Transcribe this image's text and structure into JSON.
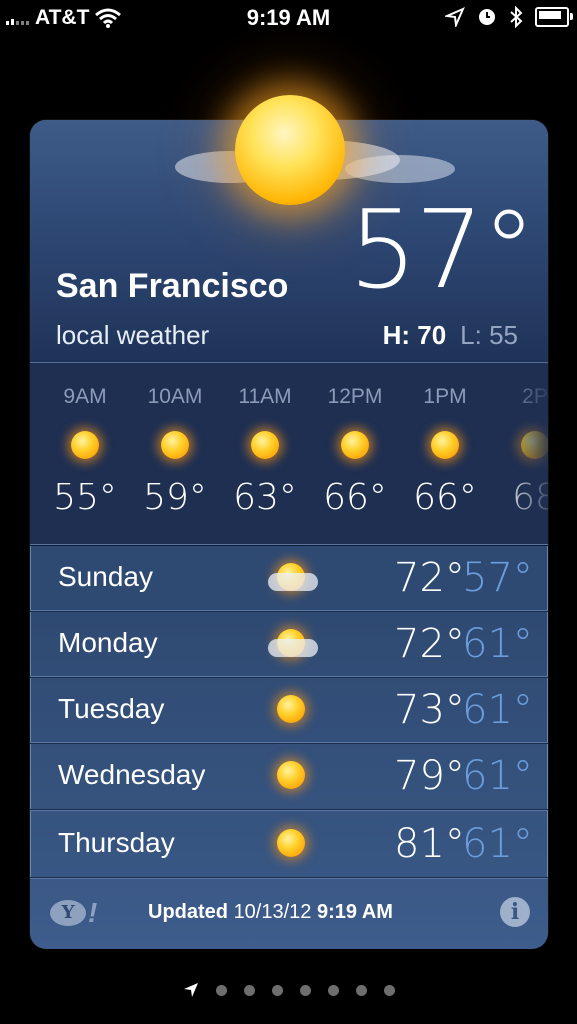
{
  "status_bar": {
    "carrier": "AT&T",
    "time": "9:19 AM"
  },
  "header": {
    "city": "San Francisco",
    "subtitle": "local weather",
    "current_temp": "57°",
    "high": "H: 70",
    "low": "L: 55"
  },
  "hourly": [
    {
      "time": "9AM",
      "temp": "55°",
      "icon": "sun-icon"
    },
    {
      "time": "10AM",
      "temp": "59°",
      "icon": "sun-icon"
    },
    {
      "time": "11AM",
      "temp": "63°",
      "icon": "sun-icon"
    },
    {
      "time": "12PM",
      "temp": "66°",
      "icon": "sun-icon"
    },
    {
      "time": "1PM",
      "temp": "66°",
      "icon": "sun-icon"
    },
    {
      "time": "2P",
      "temp": "68",
      "icon": "sun-icon"
    }
  ],
  "daily": [
    {
      "day": "Sunday",
      "high": "72°",
      "low": "57°",
      "icon": "partly-cloudy-icon"
    },
    {
      "day": "Monday",
      "high": "72°",
      "low": "61°",
      "icon": "partly-cloudy-icon"
    },
    {
      "day": "Tuesday",
      "high": "73°",
      "low": "61°",
      "icon": "sun-icon"
    },
    {
      "day": "Wednesday",
      "high": "79°",
      "low": "61°",
      "icon": "sun-icon"
    },
    {
      "day": "Thursday",
      "high": "81°",
      "low": "61°",
      "icon": "sun-icon"
    }
  ],
  "footer": {
    "updated_label": "Updated",
    "updated_date": "10/13/12",
    "updated_time": "9:19 AM",
    "yahoo_letter": "Y",
    "yahoo_bang": "!",
    "info_label": "i"
  },
  "colors": {
    "low_temp": "#6b9cdc",
    "card_blue": "#2e4a74"
  }
}
